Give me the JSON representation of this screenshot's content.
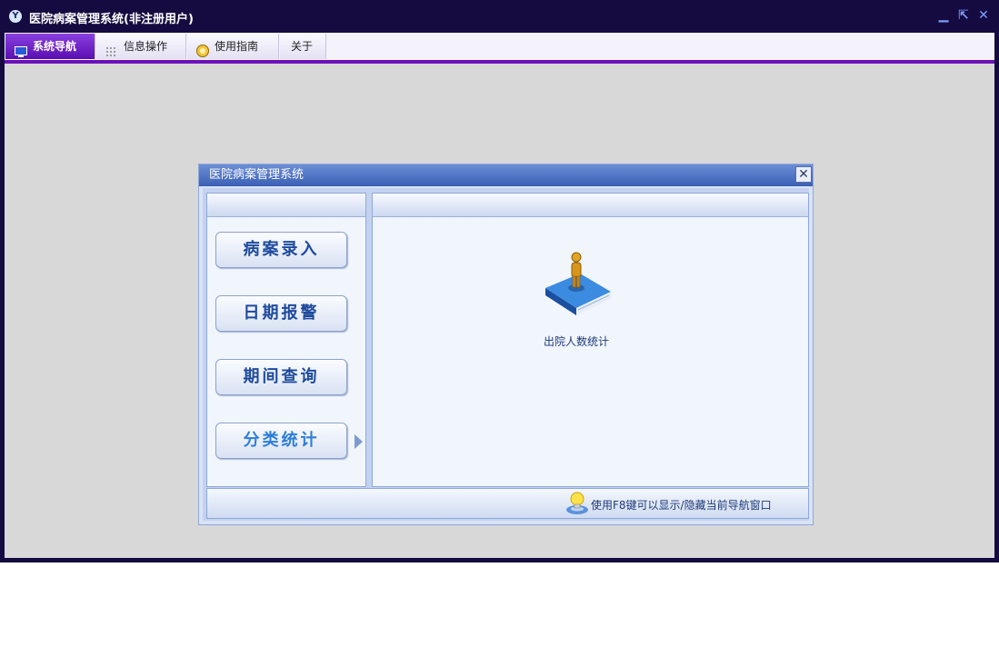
{
  "app": {
    "icon_glyph": "Y",
    "title": "医院病案管理系统(非注册用户)",
    "minimize_glyph": "▁",
    "restore_glyph": "⇱",
    "close_glyph": "✕"
  },
  "menu": {
    "tabs": [
      {
        "label": "系统导航",
        "icon": "monitor-icon"
      },
      {
        "label": "信息操作",
        "icon": "grid-icon"
      },
      {
        "label": "使用指南",
        "icon": "help-icon"
      },
      {
        "label": "关于",
        "icon": ""
      }
    ],
    "active_color": "#6a12b8"
  },
  "dialog": {
    "title": "医院病案管理系统",
    "close_glyph": "✕",
    "nav_buttons": [
      {
        "label": "病案录入"
      },
      {
        "label": "日期报警"
      },
      {
        "label": "期间查询"
      },
      {
        "label": "分类统计",
        "selected": true
      }
    ],
    "content_items": [
      {
        "label": "出院人数统计",
        "icon": "person-on-book-icon"
      }
    ],
    "tip": "使用F8键可以显示/隐藏当前导航窗口"
  }
}
